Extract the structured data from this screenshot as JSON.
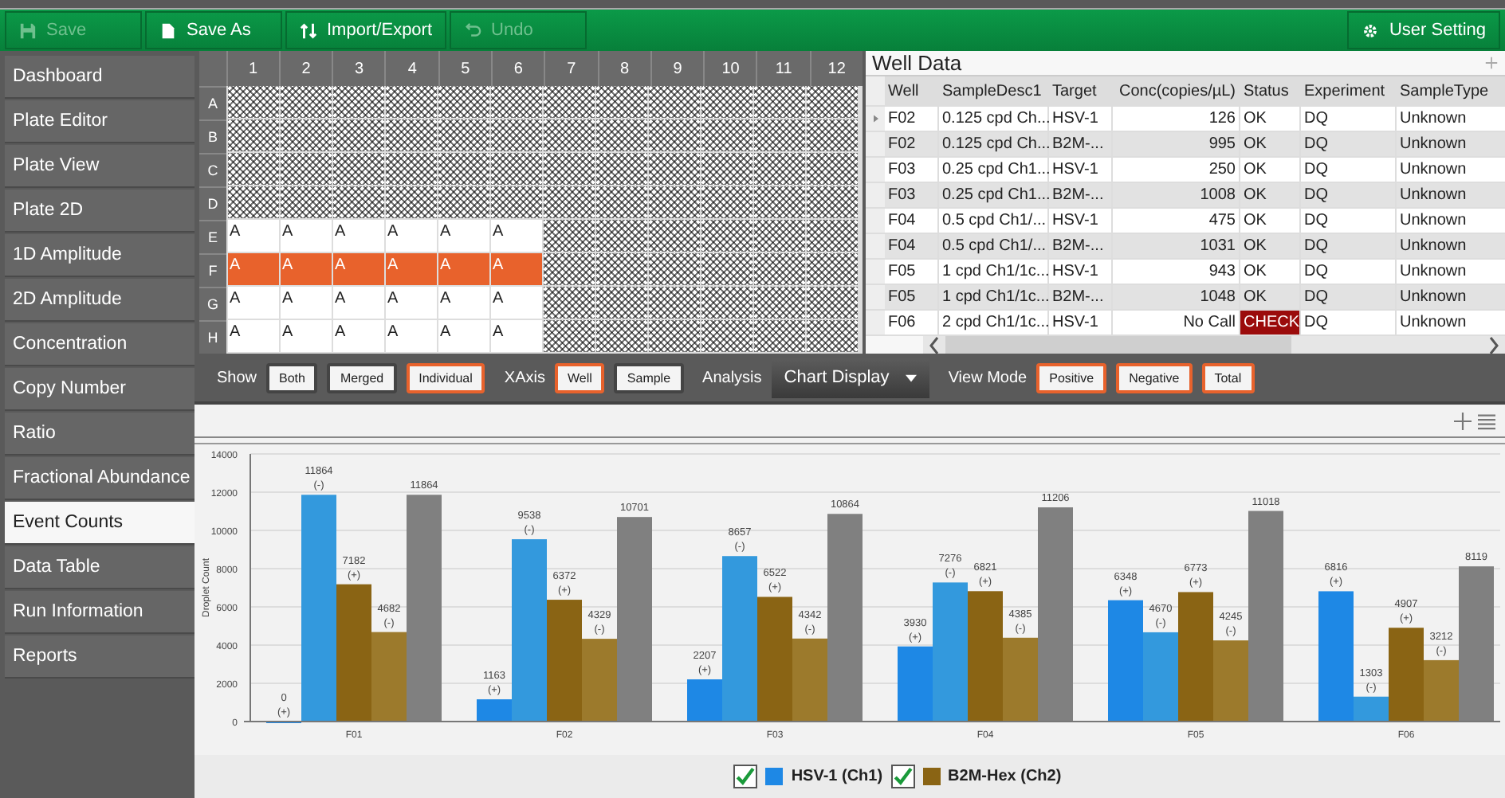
{
  "toolbar": {
    "buttons": [
      {
        "label": "Save",
        "kind": "save",
        "disabled": true
      },
      {
        "label": "Save As",
        "kind": "saveas",
        "disabled": false
      },
      {
        "label": "Import/Export",
        "kind": "importexport",
        "disabled": false
      },
      {
        "label": "Undo",
        "kind": "undo",
        "disabled": true
      }
    ],
    "settings": {
      "label": "User Setting"
    }
  },
  "sidebar": {
    "items": [
      {
        "label": "Dashboard",
        "selected": false
      },
      {
        "label": "Plate Editor",
        "selected": false
      },
      {
        "label": "Plate View",
        "selected": false
      },
      {
        "label": "Plate 2D",
        "selected": false
      },
      {
        "label": "1D Amplitude",
        "selected": false
      },
      {
        "label": "2D Amplitude",
        "selected": false
      },
      {
        "label": "Concentration",
        "selected": false
      },
      {
        "label": "Copy Number",
        "selected": false
      },
      {
        "label": "Ratio",
        "selected": false
      },
      {
        "label": "Fractional Abundance",
        "selected": false
      },
      {
        "label": "Event Counts",
        "selected": true
      },
      {
        "label": "Data Table",
        "selected": false
      },
      {
        "label": "Run Information",
        "selected": false
      },
      {
        "label": "Reports",
        "selected": false
      }
    ]
  },
  "plate": {
    "columns": [
      "1",
      "2",
      "3",
      "4",
      "5",
      "6",
      "7",
      "8",
      "9",
      "10",
      "11",
      "12"
    ],
    "rows": [
      {
        "label": "A",
        "wells": [
          {
            "kind": "empty"
          },
          {
            "kind": "empty"
          },
          {
            "kind": "empty"
          },
          {
            "kind": "empty"
          },
          {
            "kind": "empty"
          },
          {
            "kind": "empty"
          },
          {
            "kind": "empty"
          },
          {
            "kind": "empty"
          },
          {
            "kind": "empty"
          },
          {
            "kind": "empty"
          },
          {
            "kind": "empty"
          },
          {
            "kind": "empty"
          }
        ]
      },
      {
        "label": "B",
        "wells": [
          {
            "kind": "empty"
          },
          {
            "kind": "empty"
          },
          {
            "kind": "empty"
          },
          {
            "kind": "empty"
          },
          {
            "kind": "empty"
          },
          {
            "kind": "empty"
          },
          {
            "kind": "empty"
          },
          {
            "kind": "empty"
          },
          {
            "kind": "empty"
          },
          {
            "kind": "empty"
          },
          {
            "kind": "empty"
          },
          {
            "kind": "empty"
          }
        ]
      },
      {
        "label": "C",
        "wells": [
          {
            "kind": "empty"
          },
          {
            "kind": "empty"
          },
          {
            "kind": "empty"
          },
          {
            "kind": "empty"
          },
          {
            "kind": "empty"
          },
          {
            "kind": "empty"
          },
          {
            "kind": "empty"
          },
          {
            "kind": "empty"
          },
          {
            "kind": "empty"
          },
          {
            "kind": "empty"
          },
          {
            "kind": "empty"
          },
          {
            "kind": "empty"
          }
        ]
      },
      {
        "label": "D",
        "wells": [
          {
            "kind": "empty"
          },
          {
            "kind": "empty"
          },
          {
            "kind": "empty"
          },
          {
            "kind": "empty"
          },
          {
            "kind": "empty"
          },
          {
            "kind": "empty"
          },
          {
            "kind": "empty"
          },
          {
            "kind": "empty"
          },
          {
            "kind": "empty"
          },
          {
            "kind": "empty"
          },
          {
            "kind": "empty"
          },
          {
            "kind": "empty"
          }
        ]
      },
      {
        "label": "E",
        "wells": [
          {
            "kind": "sample",
            "text": "A",
            "selected": false
          },
          {
            "kind": "sample",
            "text": "A",
            "selected": false
          },
          {
            "kind": "sample",
            "text": "A",
            "selected": false
          },
          {
            "kind": "sample",
            "text": "A",
            "selected": false
          },
          {
            "kind": "sample",
            "text": "A",
            "selected": false
          },
          {
            "kind": "sample",
            "text": "A",
            "selected": false
          },
          {
            "kind": "empty"
          },
          {
            "kind": "empty"
          },
          {
            "kind": "empty"
          },
          {
            "kind": "empty"
          },
          {
            "kind": "empty"
          },
          {
            "kind": "empty"
          }
        ]
      },
      {
        "label": "F",
        "wells": [
          {
            "kind": "sample",
            "text": "A",
            "selected": true
          },
          {
            "kind": "sample",
            "text": "A",
            "selected": true
          },
          {
            "kind": "sample",
            "text": "A",
            "selected": true
          },
          {
            "kind": "sample",
            "text": "A",
            "selected": true
          },
          {
            "kind": "sample",
            "text": "A",
            "selected": true
          },
          {
            "kind": "sample",
            "text": "A",
            "selected": true
          },
          {
            "kind": "empty"
          },
          {
            "kind": "empty"
          },
          {
            "kind": "empty"
          },
          {
            "kind": "empty"
          },
          {
            "kind": "empty"
          },
          {
            "kind": "empty"
          }
        ]
      },
      {
        "label": "G",
        "wells": [
          {
            "kind": "sample",
            "text": "A",
            "selected": false
          },
          {
            "kind": "sample",
            "text": "A",
            "selected": false
          },
          {
            "kind": "sample",
            "text": "A",
            "selected": false
          },
          {
            "kind": "sample",
            "text": "A",
            "selected": false
          },
          {
            "kind": "sample",
            "text": "A",
            "selected": false
          },
          {
            "kind": "sample",
            "text": "A",
            "selected": false
          },
          {
            "kind": "empty"
          },
          {
            "kind": "empty"
          },
          {
            "kind": "empty"
          },
          {
            "kind": "empty"
          },
          {
            "kind": "empty"
          },
          {
            "kind": "empty"
          }
        ]
      },
      {
        "label": "H",
        "wells": [
          {
            "kind": "sample",
            "text": "A",
            "selected": false
          },
          {
            "kind": "sample",
            "text": "A",
            "selected": false
          },
          {
            "kind": "sample",
            "text": "A",
            "selected": false
          },
          {
            "kind": "sample",
            "text": "A",
            "selected": false
          },
          {
            "kind": "sample",
            "text": "A",
            "selected": false
          },
          {
            "kind": "sample",
            "text": "A",
            "selected": false
          },
          {
            "kind": "empty"
          },
          {
            "kind": "empty"
          },
          {
            "kind": "empty"
          },
          {
            "kind": "empty"
          },
          {
            "kind": "empty"
          },
          {
            "kind": "empty"
          }
        ]
      }
    ]
  },
  "well_data": {
    "title": "Well Data",
    "columns": [
      "Well",
      "SampleDesc1",
      "Target",
      "Conc(copies/µL)",
      "Status",
      "Experiment",
      "SampleType"
    ],
    "rows": [
      {
        "current": true,
        "flagged": false,
        "cells": [
          "F02",
          "0.125 cpd Ch...",
          "HSV-1",
          "126",
          "OK",
          "DQ",
          "Unknown"
        ]
      },
      {
        "current": false,
        "flagged": false,
        "cells": [
          "F02",
          "0.125 cpd Ch...",
          "B2M-...",
          "995",
          "OK",
          "DQ",
          "Unknown"
        ]
      },
      {
        "current": false,
        "flagged": false,
        "cells": [
          "F03",
          "0.25 cpd Ch1...",
          "HSV-1",
          "250",
          "OK",
          "DQ",
          "Unknown"
        ]
      },
      {
        "current": false,
        "flagged": false,
        "cells": [
          "F03",
          "0.25 cpd Ch1...",
          "B2M-...",
          "1008",
          "OK",
          "DQ",
          "Unknown"
        ]
      },
      {
        "current": false,
        "flagged": false,
        "cells": [
          "F04",
          "0.5 cpd Ch1/...",
          "HSV-1",
          "475",
          "OK",
          "DQ",
          "Unknown"
        ]
      },
      {
        "current": false,
        "flagged": false,
        "cells": [
          "F04",
          "0.5 cpd Ch1/...",
          "B2M-...",
          "1031",
          "OK",
          "DQ",
          "Unknown"
        ]
      },
      {
        "current": false,
        "flagged": false,
        "cells": [
          "F05",
          "1 cpd Ch1/1c...",
          "HSV-1",
          "943",
          "OK",
          "DQ",
          "Unknown"
        ]
      },
      {
        "current": false,
        "flagged": false,
        "cells": [
          "F05",
          "1 cpd Ch1/1c...",
          "B2M-...",
          "1048",
          "OK",
          "DQ",
          "Unknown"
        ]
      },
      {
        "current": false,
        "flagged": true,
        "cells": [
          "F06",
          "2 cpd Ch1/1c...",
          "HSV-1",
          "No Call",
          "CHECK",
          "DQ",
          "Unknown"
        ]
      }
    ]
  },
  "controls": [
    {
      "label": "Show",
      "kind": "toggles",
      "options": [
        {
          "label": "Both",
          "selected": false
        },
        {
          "label": "Merged",
          "selected": false
        },
        {
          "label": "Individual",
          "selected": true
        }
      ]
    },
    {
      "label": "XAxis",
      "kind": "toggles",
      "options": [
        {
          "label": "Well",
          "selected": true
        },
        {
          "label": "Sample",
          "selected": false
        }
      ]
    },
    {
      "label": "Analysis",
      "kind": "dropdown",
      "value": "Chart Display"
    },
    {
      "label": "View Mode",
      "kind": "toggles",
      "options": [
        {
          "label": "Positive",
          "selected": true
        },
        {
          "label": "Negative",
          "selected": true
        },
        {
          "label": "Total",
          "selected": true
        }
      ]
    }
  ],
  "chart": {
    "chart_data": {
      "type": "bar",
      "ylabel": "Droplet Count",
      "categories": [
        "F01",
        "F02",
        "F03",
        "F04",
        "F05",
        "F06"
      ],
      "series": [
        {
          "color": "#1e88e5",
          "values": [
            0,
            1163,
            2207,
            3930,
            6348,
            6816
          ]
        },
        {
          "color": "#3399dd",
          "values": [
            11864,
            9538,
            8657,
            7276,
            4670,
            1303
          ]
        },
        {
          "color": "#8a6414",
          "values": [
            7182,
            6372,
            6522,
            6821,
            6773,
            4907
          ]
        },
        {
          "color": "#9c7a2c",
          "values": [
            4682,
            4329,
            4342,
            4385,
            4245,
            3212
          ]
        },
        {
          "color": "#808080",
          "values": [
            11864,
            10701,
            10864,
            11206,
            11018,
            8119
          ]
        }
      ],
      "ylim": [
        0,
        14000
      ],
      "grid": true,
      "yticks": [
        0,
        2000,
        4000,
        6000,
        8000,
        10000,
        12000,
        14000
      ],
      "value_labels": [
        [
          [
            "0",
            "(+)"
          ],
          [
            "1163",
            "(+)"
          ],
          [
            "2207",
            "(+)"
          ],
          [
            "3930",
            "(+)"
          ],
          [
            "6348",
            "(+)"
          ],
          [
            "6816",
            "(+)"
          ]
        ],
        [
          [
            "11864",
            "(-)"
          ],
          [
            "9538",
            "(-)"
          ],
          [
            "8657",
            "(-)"
          ],
          [
            "7276",
            "(-)"
          ],
          [
            "4670",
            "(-)"
          ],
          [
            "1303",
            "(-)"
          ]
        ],
        [
          [
            "7182",
            "(+)"
          ],
          [
            "6372",
            "(+)"
          ],
          [
            "6522",
            "(+)"
          ],
          [
            "6821",
            "(+)"
          ],
          [
            "6773",
            "(+)"
          ],
          [
            "4907",
            "(+)"
          ]
        ],
        [
          [
            "4682",
            "(-)"
          ],
          [
            "4329",
            "(-)"
          ],
          [
            "4342",
            "(-)"
          ],
          [
            "4385",
            "(-)"
          ],
          [
            "4245",
            "(-)"
          ],
          [
            "3212",
            "(-)"
          ]
        ],
        [
          [
            "11864"
          ],
          [
            "10701"
          ],
          [
            "10864"
          ],
          [
            "11206"
          ],
          [
            "11018"
          ],
          [
            "8119"
          ]
        ]
      ]
    },
    "legend": [
      {
        "label": "HSV-1 (Ch1)",
        "color": "#1e88e5",
        "checked": true
      },
      {
        "label": "B2M-Hex (Ch2)",
        "color": "#8a6414",
        "checked": true
      }
    ]
  }
}
